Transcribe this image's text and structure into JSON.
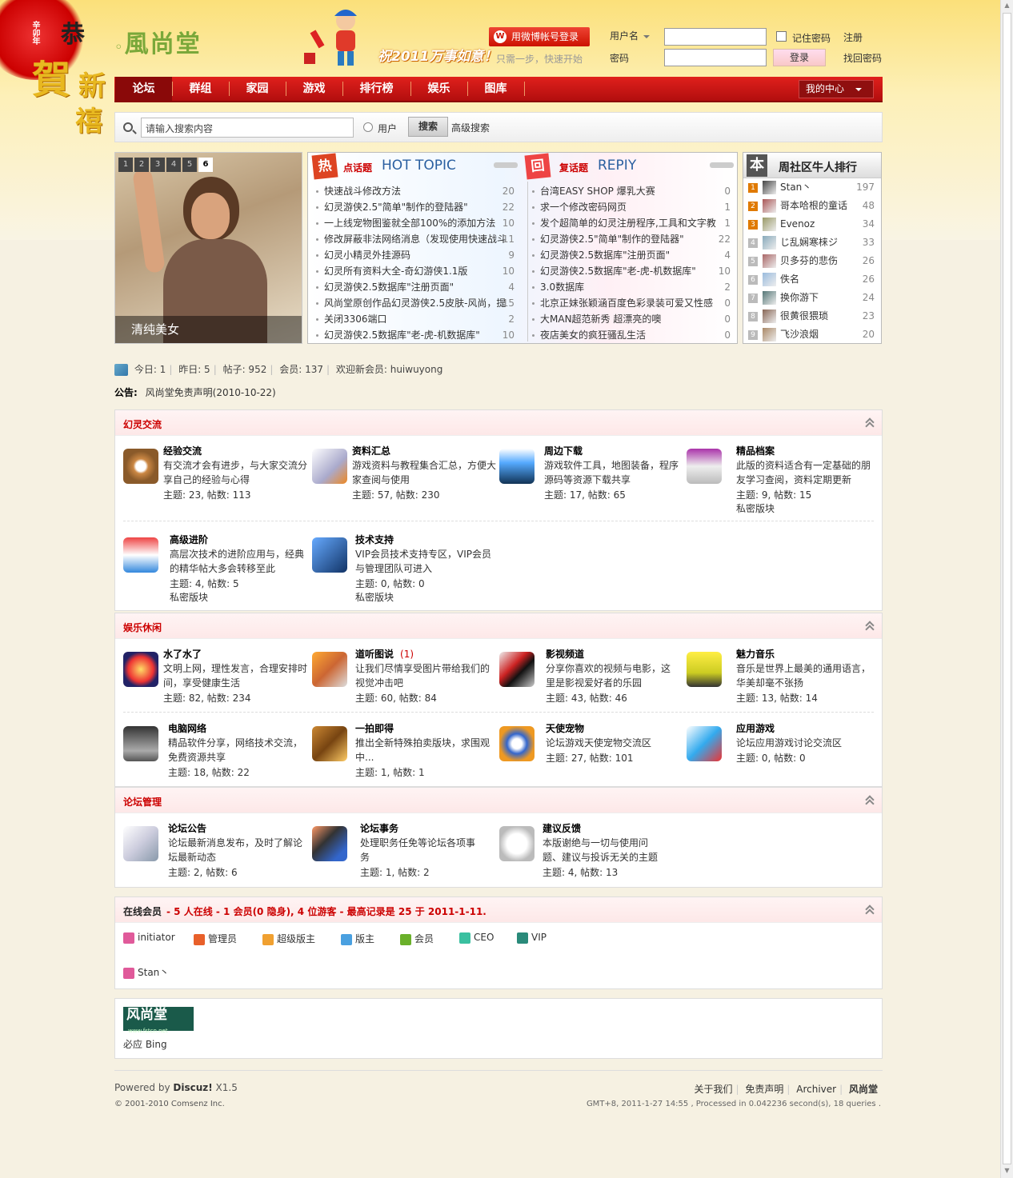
{
  "header": {
    "logo_text": "風尚堂",
    "ornament_text": "恭賀新禧",
    "ornament_year": "辛卯年",
    "slogan": "祝2011万事如意！",
    "weibo_button": "用微博帐号登录",
    "weibo_sub": "只需一步，快速开始",
    "username_label": "用户名",
    "password_label": "密码",
    "remember_label": "记住密码",
    "login_button": "登录",
    "register_link": "注册",
    "forgot_link": "找回密码"
  },
  "nav": {
    "items": [
      "论坛",
      "群组",
      "家园",
      "游戏",
      "排行榜",
      "娱乐",
      "图库"
    ],
    "my_center": "我的中心"
  },
  "search": {
    "placeholder": "请输入搜索内容",
    "user_label": "用户",
    "button": "搜索",
    "advanced": "高级搜索"
  },
  "slideshow": {
    "tabs": [
      "1",
      "2",
      "3",
      "4",
      "5",
      "6"
    ],
    "active_tab": "6",
    "caption": "清纯美女"
  },
  "hot_topics": {
    "icon": "热",
    "label": "点话题",
    "title": "HOT TOPIC",
    "items": [
      {
        "title": "快速战斗修改方法",
        "count": "20"
      },
      {
        "title": "幻灵游侠2.5\"简单\"制作的登陆器\"",
        "count": "22"
      },
      {
        "title": "一上线宠物图鉴就全部100%的添加方法",
        "count": "10"
      },
      {
        "title": "修改屏蔽非法网络消息（发现使用快速战斗",
        "count": "11"
      },
      {
        "title": "幻灵小精灵外挂源码",
        "count": "9"
      },
      {
        "title": "幻灵所有资料大全-奇幻游侠1.1版",
        "count": "10"
      },
      {
        "title": "幻灵游侠2.5数据库\"注册页面\"",
        "count": "4"
      },
      {
        "title": "风尚堂原创作品幻灵游侠2.5皮肤-风尚，提",
        "count": "15"
      },
      {
        "title": "关闭3306端口",
        "count": "2"
      },
      {
        "title": "幻灵游侠2.5数据库\"老-虎-机数据库\"",
        "count": "10"
      }
    ]
  },
  "reply_topics": {
    "icon": "回",
    "label": "复话题",
    "title": "REPIY",
    "items": [
      {
        "title": "台湾EASY SHOP 爆乳大赛",
        "count": "0"
      },
      {
        "title": "求一个修改密码网页",
        "count": "1"
      },
      {
        "title": "发个超简单的幻灵注册程序,工具和文字教",
        "count": "1"
      },
      {
        "title": "幻灵游侠2.5\"简单\"制作的登陆器\"",
        "count": "22"
      },
      {
        "title": "幻灵游侠2.5数据库\"注册页面\"",
        "count": "4"
      },
      {
        "title": "幻灵游侠2.5数据库\"老-虎-机数据库\"",
        "count": "10"
      },
      {
        "title": "3.0数据库",
        "count": "2"
      },
      {
        "title": "北京正妹张颖涵百度色彩录装可爱又性感",
        "count": "0"
      },
      {
        "title": "大MAN超范新秀  超漂亮的噢",
        "count": "0"
      },
      {
        "title": "夜店美女的疯狂骚乱生活",
        "count": "0"
      }
    ]
  },
  "ranking": {
    "icon": "本",
    "title": "周社区牛人排行",
    "items": [
      {
        "rank": "1",
        "name": "Stan丶",
        "score": "197"
      },
      {
        "rank": "2",
        "name": "哥本哈根的童话",
        "score": "48"
      },
      {
        "rank": "3",
        "name": "Evenoz",
        "score": "34"
      },
      {
        "rank": "4",
        "name": "じ乱娴寒梾ジ",
        "score": "33"
      },
      {
        "rank": "5",
        "name": "贝多芬的悲伤",
        "score": "26"
      },
      {
        "rank": "6",
        "name": "佚名",
        "score": "26"
      },
      {
        "rank": "7",
        "name": "换你游下",
        "score": "24"
      },
      {
        "rank": "8",
        "name": "很黄很猥琐",
        "score": "23"
      },
      {
        "rank": "9",
        "name": "飞沙浪烟",
        "score": "20"
      }
    ]
  },
  "stats": {
    "today": "今日: 1",
    "yesterday": "昨日: 5",
    "posts": "帖子: 952",
    "members": "会员: 137",
    "newest": "欢迎新会员: huiwuyong"
  },
  "notice": {
    "label": "公告:",
    "text": "风尚堂免责声明(2010-10-22)"
  },
  "sections": [
    {
      "title": "幻灵交流",
      "forums": [
        {
          "name": "经验交流",
          "desc1": "有交流才会有进步，与大家交流分",
          "desc2": "享自己的经验与心得",
          "stats": "主题: 23, 帖数: 113",
          "private": ""
        },
        {
          "name": "资料汇总",
          "desc1": "游戏资料与教程集合汇总，方便大",
          "desc2": "家查阅与使用",
          "stats": "主题: 57, 帖数: 230",
          "private": ""
        },
        {
          "name": "周边下载",
          "desc1": "游戏软件工具，地图装备，程序",
          "desc2": "源码等资源下载共享",
          "stats": "主题: 17, 帖数: 65",
          "private": ""
        },
        {
          "name": "精品档案",
          "desc1": "此版的资料适合有一定基础的朋",
          "desc2": "友学习查阅，资料定期更新",
          "stats": "主题: 9, 帖数: 15",
          "private": "私密版块"
        },
        {
          "name": "高级进阶",
          "desc1": "高层次技术的进阶应用与，经典",
          "desc2": "的精华帖大多会转移至此",
          "stats": "主题: 4, 帖数: 5",
          "private": "私密版块"
        },
        {
          "name": "技术支持",
          "desc1": "VIP会员技术支持专区，VIP会员",
          "desc2": "与管理团队可进入",
          "stats": "主题: 0, 帖数: 0",
          "private": "私密版块"
        }
      ]
    },
    {
      "title": "娱乐休闲",
      "forums": [
        {
          "name": "水了水了",
          "desc1": "文明上网，理性发言，合理安排时",
          "desc2": "间，享受健康生活",
          "stats": "主题: 82, 帖数: 234",
          "new": ""
        },
        {
          "name": "道听图说",
          "desc1": "让我们尽情享受图片带给我们的",
          "desc2": "视觉冲击吧",
          "stats": "主题: 60, 帖数: 84",
          "new": "(1)"
        },
        {
          "name": "影视频道",
          "desc1": "分享你喜欢的视频与电影，这",
          "desc2": "里是影视爱好者的乐园",
          "stats": "主题: 43, 帖数: 46",
          "new": ""
        },
        {
          "name": "魅力音乐",
          "desc1": "音乐是世界上最美的通用语言，",
          "desc2": "华美却毫不张扬",
          "stats": "主题: 13, 帖数: 14",
          "new": ""
        },
        {
          "name": "电脑网络",
          "desc1": "精品软件分享，网络技术交流，",
          "desc2": "免费资源共享",
          "stats": "主题: 18, 帖数: 22",
          "new": ""
        },
        {
          "name": "一拍即得",
          "desc1": "推出全新特殊拍卖版块，求围观",
          "desc2": "中...",
          "stats": "主题: 1, 帖数: 1",
          "new": ""
        },
        {
          "name": "天使宠物",
          "desc1": "论坛游戏天使宠物交流区",
          "desc2": "",
          "stats": "主题: 27, 帖数: 101",
          "new": ""
        },
        {
          "name": "应用游戏",
          "desc1": "论坛应用游戏讨论交流区",
          "desc2": "",
          "stats": "主题: 0, 帖数: 0",
          "new": ""
        }
      ]
    },
    {
      "title": "论坛管理",
      "forums": [
        {
          "name": "论坛公告",
          "desc1": "论坛最新消息发布，及时了解论",
          "desc2": "坛最新动态",
          "stats": "主题: 2, 帖数: 6"
        },
        {
          "name": "论坛事务",
          "desc1": "处理职务任免等论坛各项事",
          "desc2": "务",
          "stats": "主题: 1, 帖数: 2"
        },
        {
          "name": "建议反馈",
          "desc1": "本版谢绝与一切与使用问",
          "desc2": "题、建议与投诉无关的主题",
          "stats": "主题: 4, 帖数: 13"
        }
      ]
    }
  ],
  "online": {
    "title": "在线会员",
    "summary": "- 5 人在线  - 1 会员(0 隐身), 4 位游客  - 最高记录是  25 于  2011-1-11.",
    "legend": [
      {
        "label": "initiator",
        "color": "#e05a9a"
      },
      {
        "label": "管理员",
        "color": "#e8602a"
      },
      {
        "label": "超级版主",
        "color": "#f0a030"
      },
      {
        "label": "版主",
        "color": "#4aa0e0"
      },
      {
        "label": "会员",
        "color": "#6ab02a"
      },
      {
        "label": "CEO",
        "color": "#3ac0a0"
      },
      {
        "label": "VIP",
        "color": "#2a8a7a"
      }
    ],
    "users": [
      "Stan丶"
    ]
  },
  "links": {
    "logo_text": "风尚堂",
    "logo_url_text": "www.fstcn.net",
    "items": "必应  Bing"
  },
  "footer": {
    "powered_prefix": "Powered by ",
    "powered_name": "Discuz!",
    "powered_ver": " X1.5",
    "copyright": "© 2001-2010 Comsenz Inc.",
    "links": [
      "关于我们",
      "免责声明",
      "Archiver",
      "风尚堂"
    ],
    "gmt": "GMT+8, 2011-1-27 14:55 , Processed in 0.042236 second(s), 18 queries ."
  }
}
